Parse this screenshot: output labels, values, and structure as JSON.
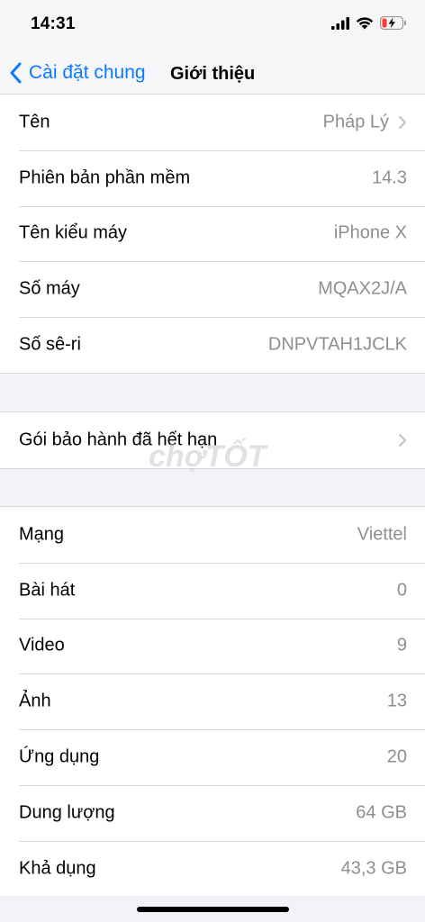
{
  "status": {
    "time": "14:31"
  },
  "nav": {
    "back_label": "Cài đặt chung",
    "title": "Giới thiệu"
  },
  "group1": [
    {
      "label": "Tên",
      "value": "Pháp Lý",
      "chevron": true
    },
    {
      "label": "Phiên bản phần mềm",
      "value": "14.3"
    },
    {
      "label": "Tên kiểu máy",
      "value": "iPhone X"
    },
    {
      "label": "Số máy",
      "value": "MQAX2J/A"
    },
    {
      "label": "Số sê-ri",
      "value": "DNPVTAH1JCLK"
    }
  ],
  "group2": [
    {
      "label": "Gói bảo hành đã hết hạn",
      "chevron": true
    }
  ],
  "group3": [
    {
      "label": "Mạng",
      "value": "Viettel"
    },
    {
      "label": "Bài hát",
      "value": "0"
    },
    {
      "label": "Video",
      "value": "9"
    },
    {
      "label": "Ảnh",
      "value": "13"
    },
    {
      "label": "Ứng dụng",
      "value": "20"
    },
    {
      "label": "Dung lượng",
      "value": "64 GB"
    },
    {
      "label": "Khả dụng",
      "value": "43,3 GB"
    }
  ],
  "watermark": "chợTỐT",
  "icons": [
    "signal-icon",
    "wifi-icon",
    "battery-charging-icon",
    "chevron-left-icon",
    "chevron-right-icon"
  ],
  "colors": {
    "accent": "#0a7aff",
    "battery_low": "#ff3b30",
    "secondary_text": "#8e8e93"
  }
}
